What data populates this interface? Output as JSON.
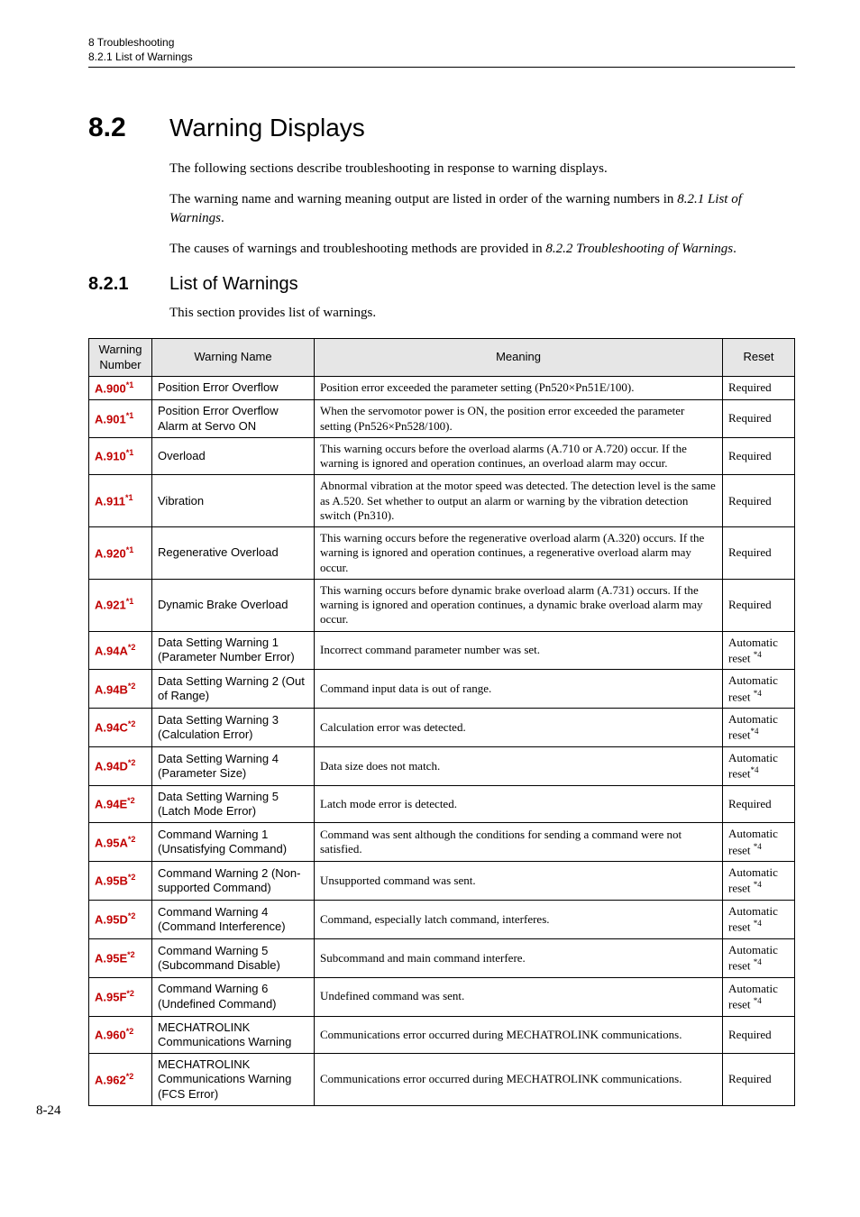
{
  "running_head": {
    "chapter": "8 Troubleshooting",
    "section": "8.2.1 List of Warnings"
  },
  "heading": {
    "number": "8.2",
    "title": "Warning Displays"
  },
  "intro": {
    "p1": "The following sections describe troubleshooting in response to warning displays.",
    "p2a": "The warning name and warning meaning output are listed in order of the warning numbers in ",
    "p2_ital": "8.2.1 List of Warnings",
    "p2b": ".",
    "p3a": "The causes of warnings and troubleshooting methods are provided in ",
    "p3_ital": "8.2.2 Troubleshooting of Warnings",
    "p3b": "."
  },
  "subheading": {
    "number": "8.2.1",
    "title": "List of Warnings",
    "p": "This section provides list of warnings."
  },
  "table": {
    "headers": {
      "number": "Warning Number",
      "name": "Warning Name",
      "meaning": "Meaning",
      "reset": "Reset"
    },
    "rows": [
      {
        "num": "A.900",
        "sup": "*1",
        "name": "Position Error Overflow",
        "meaning": "Position error exceeded the parameter setting (Pn520×Pn51E/100).",
        "reset": "Required",
        "reset_sup": ""
      },
      {
        "num": "A.901",
        "sup": "*1",
        "name": "Position Error Overflow Alarm at Servo ON",
        "meaning": "When the servomotor power is ON, the position error exceeded the parameter setting  (Pn526×Pn528/100).",
        "reset": "Required",
        "reset_sup": ""
      },
      {
        "num": "A.910",
        "sup": "*1",
        "name": "Overload",
        "meaning": "This warning occurs before the overload alarms (A.710 or A.720) occur. If the warning is ignored and operation continues, an overload alarm may occur.",
        "reset": "Required",
        "reset_sup": ""
      },
      {
        "num": "A.911",
        "sup": "*1",
        "name": "Vibration",
        "meaning": "Abnormal vibration at the motor speed was detected. The detection level is the same as A.520. Set whether to output an alarm or warning by the vibration detection switch (Pn310).",
        "reset": "Required",
        "reset_sup": ""
      },
      {
        "num": "A.920",
        "sup": "*1",
        "name": "Regenerative Overload",
        "meaning": "This warning occurs before the regenerative overload alarm (A.320) occurs. If the warning is ignored and operation continues, a regenerative overload alarm may occur.",
        "reset": "Required",
        "reset_sup": ""
      },
      {
        "num": "A.921",
        "sup": "*1",
        "name": "Dynamic Brake Overload",
        "meaning": "This warning occurs before dynamic brake overload alarm (A.731) occurs. If the warning is ignored and operation continues, a dynamic brake overload alarm may occur.",
        "reset": "Required",
        "reset_sup": ""
      },
      {
        "num": "A.94A",
        "sup": "*2",
        "name": "Data Setting Warning 1 (Parameter Number Error)",
        "meaning": "Incorrect command parameter number was set.",
        "reset": "Automatic reset ",
        "reset_sup": "*4"
      },
      {
        "num": "A.94B",
        "sup": "*2",
        "name": "Data Setting Warning 2 (Out of Range)",
        "meaning": "Command input data is out of range.",
        "reset": "Automatic reset ",
        "reset_sup": "*4"
      },
      {
        "num": "A.94C",
        "sup": "*2",
        "name": "Data Setting Warning 3 (Calculation Error)",
        "meaning": "Calculation error was detected.",
        "reset": "Automatic reset",
        "reset_sup": "*4"
      },
      {
        "num": "A.94D",
        "sup": "*2",
        "name": "Data Setting Warning 4 (Parameter Size)",
        "meaning": "Data size does not match.",
        "reset": "Automatic reset",
        "reset_sup": "*4"
      },
      {
        "num": "A.94E",
        "sup": "*2",
        "name": "Data Setting Warning 5 (Latch Mode Error)",
        "meaning": "Latch mode error is detected.",
        "reset": "Required",
        "reset_sup": ""
      },
      {
        "num": "A.95A",
        "sup": "*2",
        "name": "Command Warning 1 (Unsatisfying Command)",
        "meaning": "Command was sent although the conditions for sending a command were not satisfied.",
        "reset": "Automatic reset ",
        "reset_sup": "*4"
      },
      {
        "num": "A.95B",
        "sup": "*2",
        "name": "Command Warning 2 (Non-supported Command)",
        "meaning": "Unsupported command was sent.",
        "reset": "Automatic reset ",
        "reset_sup": "*4"
      },
      {
        "num": "A.95D",
        "sup": "*2",
        "name": "Command Warning 4 (Command Interference)",
        "meaning": "Command, especially latch command, interferes.",
        "reset": "Automatic reset ",
        "reset_sup": "*4"
      },
      {
        "num": "A.95E",
        "sup": "*2",
        "name": "Command Warning 5 (Subcommand Disable)",
        "meaning": "Subcommand and main command interfere.",
        "reset": "Automatic reset ",
        "reset_sup": "*4"
      },
      {
        "num": "A.95F",
        "sup": "*2",
        "name": "Command Warning 6 (Undefined Command)",
        "meaning": "Undefined command was sent.",
        "reset": "Automatic reset ",
        "reset_sup": "*4"
      },
      {
        "num": "A.960",
        "sup": "*2",
        "name": "MECHATROLINK Communications Warning",
        "meaning": "Communications error occurred during MECHATROLINK communications.",
        "reset": "Required",
        "reset_sup": ""
      },
      {
        "num": "A.962",
        "sup": "*2",
        "name": "MECHATROLINK Communications Warning (FCS Error)",
        "meaning": "Communications error occurred during MECHATROLINK communications.",
        "reset": "Required",
        "reset_sup": ""
      }
    ]
  },
  "page_number": "8-24"
}
